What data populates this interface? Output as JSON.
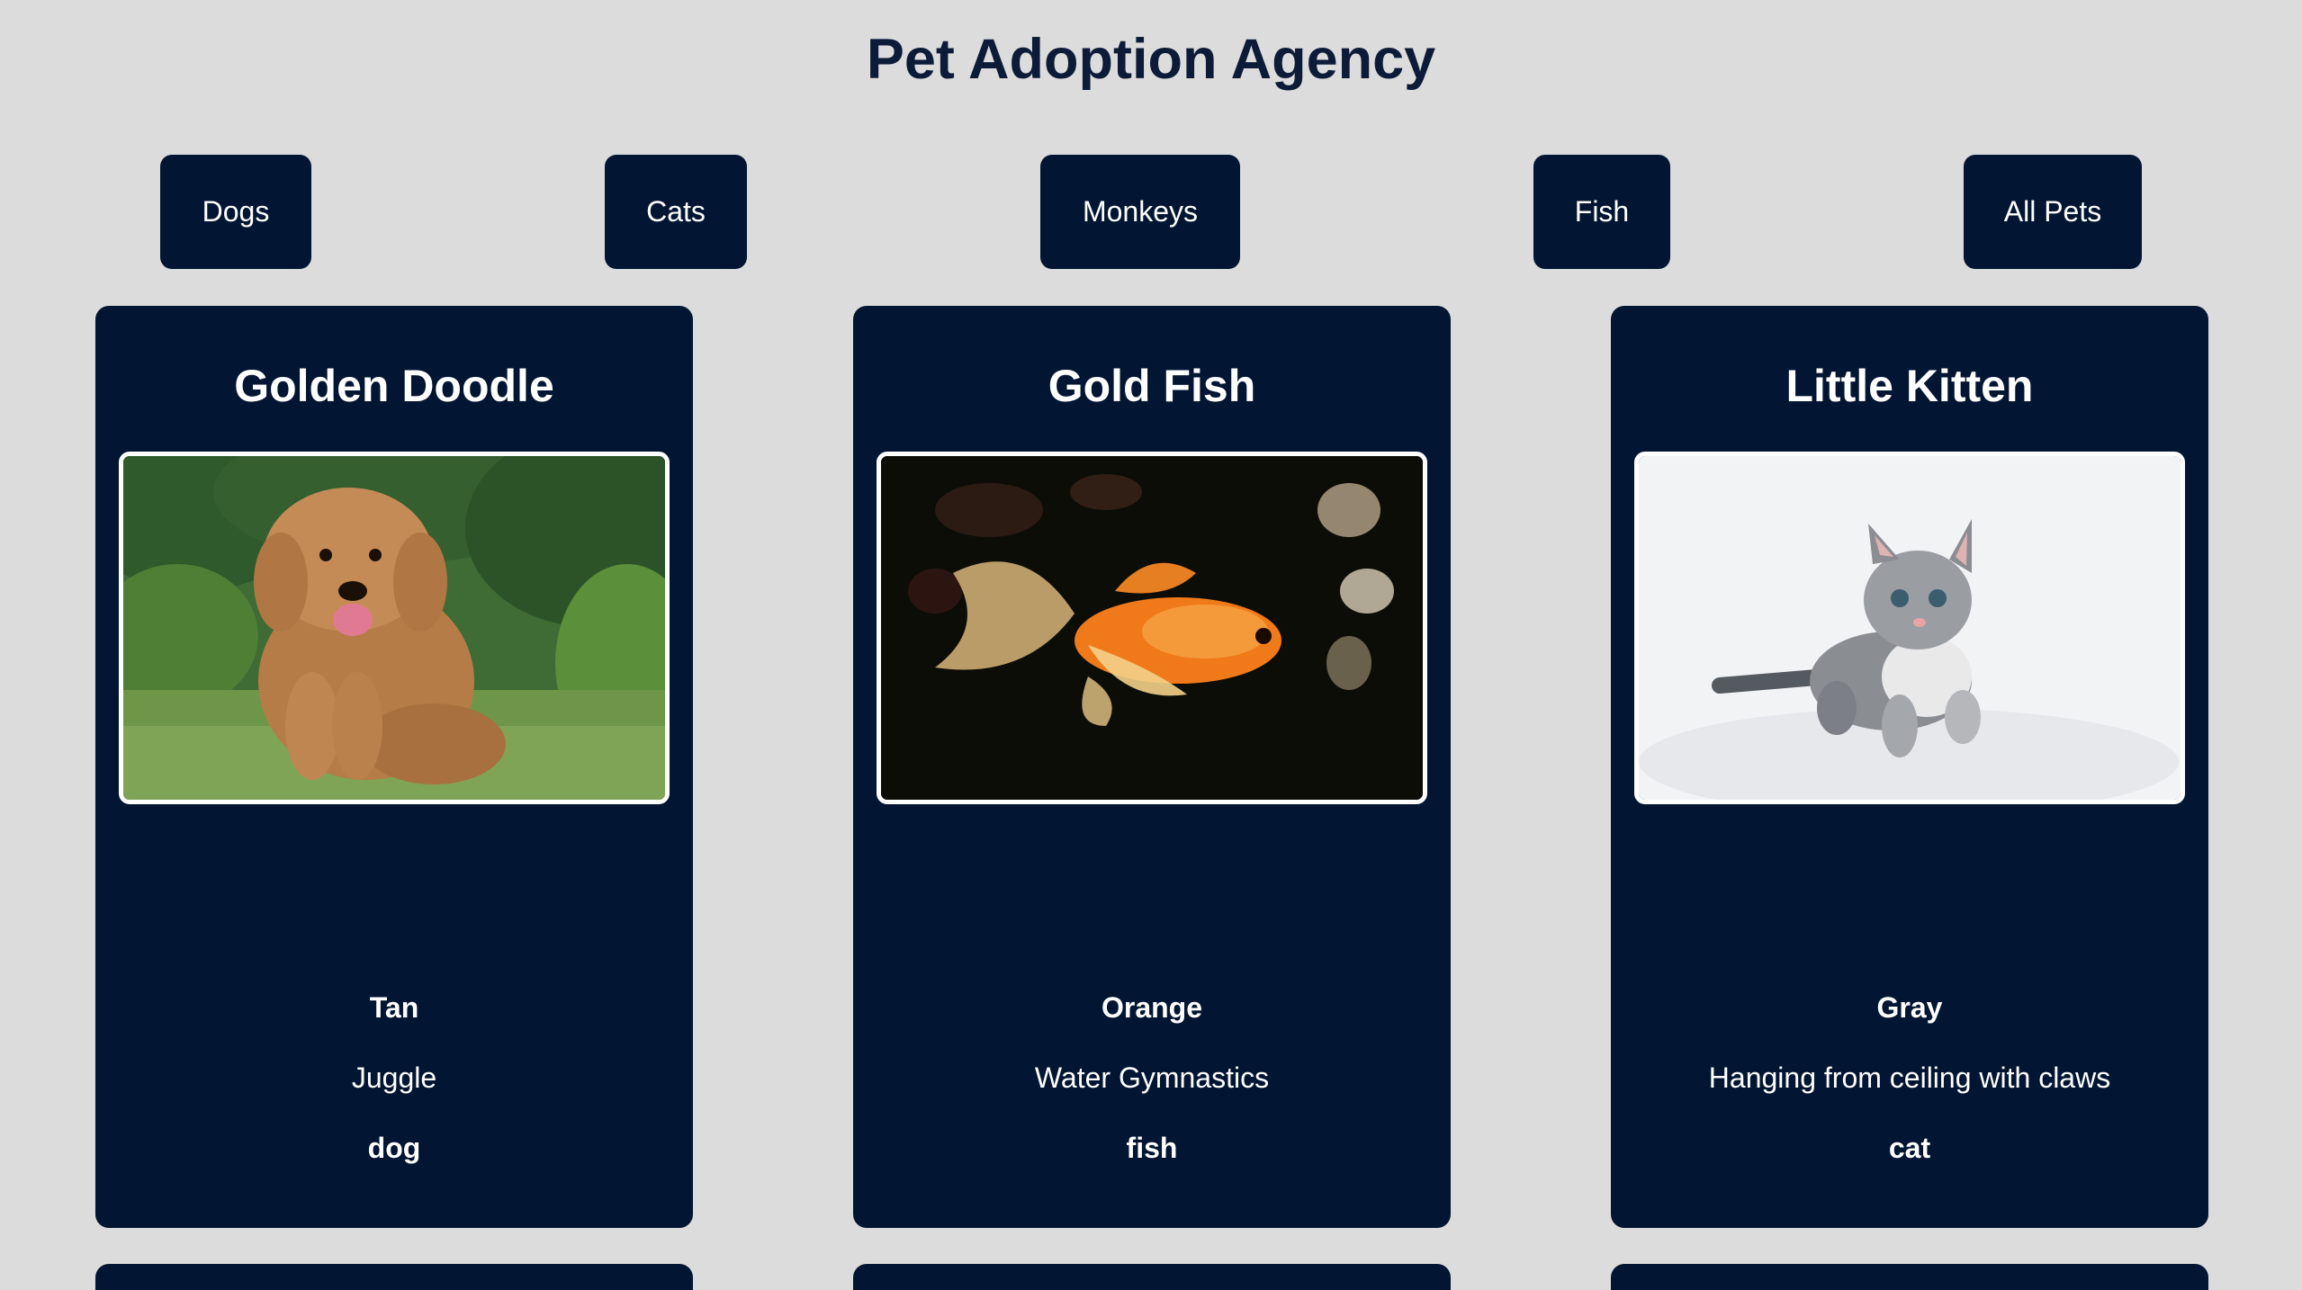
{
  "header": {
    "title": "Pet Adoption Agency"
  },
  "filters": [
    {
      "label": "Dogs"
    },
    {
      "label": "Cats"
    },
    {
      "label": "Monkeys"
    },
    {
      "label": "Fish"
    },
    {
      "label": "All Pets"
    }
  ],
  "pets": [
    {
      "name": "Golden Doodle",
      "color": "Tan",
      "trick": "Juggle",
      "type": "dog",
      "image": "golden-doodle-photo"
    },
    {
      "name": "Gold Fish",
      "color": "Orange",
      "trick": "Water Gymnastics",
      "type": "fish",
      "image": "goldfish-photo"
    },
    {
      "name": "Little Kitten",
      "color": "Gray",
      "trick": "Hanging from ceiling with claws",
      "type": "cat",
      "image": "kitten-photo"
    }
  ],
  "theme": {
    "background": "#dcdcdc",
    "card": "#021633",
    "title_text": "#0b1b38",
    "card_text": "#ffffff"
  }
}
